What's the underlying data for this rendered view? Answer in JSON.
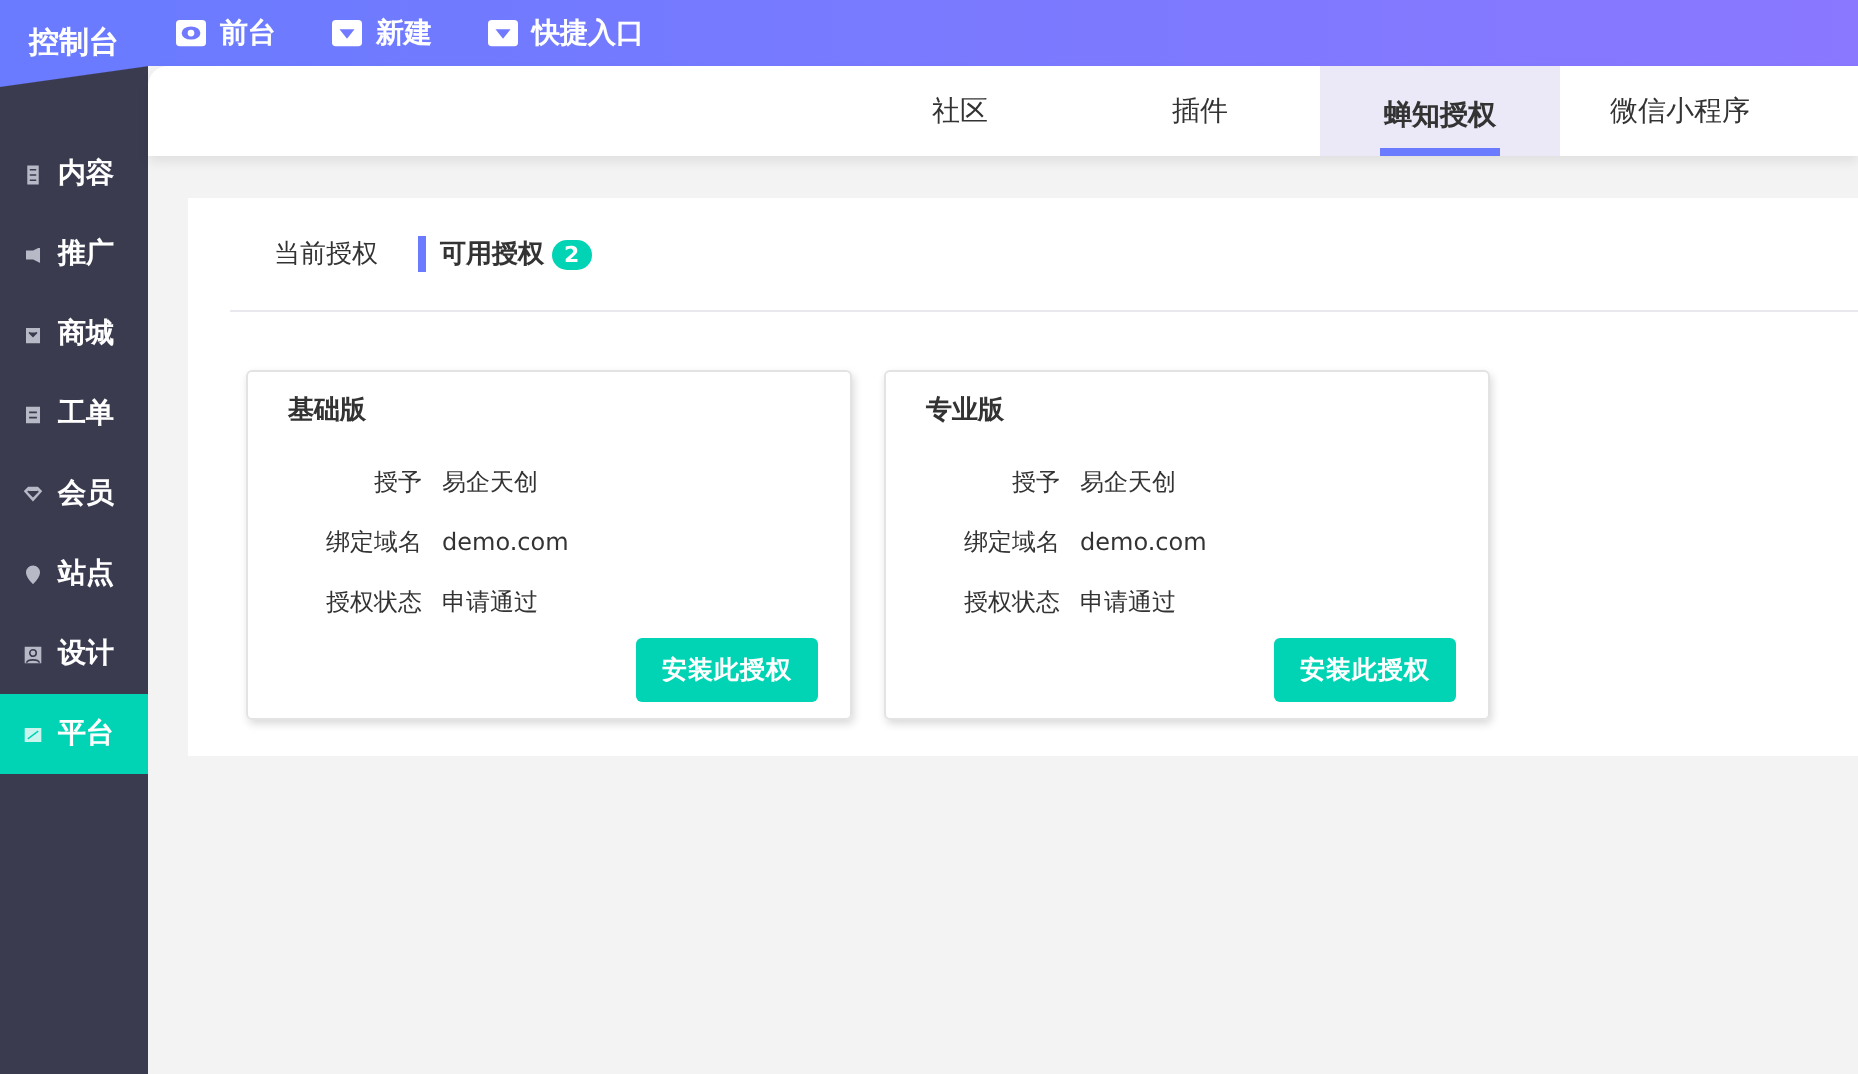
{
  "sidebar": {
    "logo": "控制台",
    "items": [
      {
        "label": "内容",
        "selected": false
      },
      {
        "label": "推广",
        "selected": false
      },
      {
        "label": "商城",
        "selected": false
      },
      {
        "label": "工单",
        "selected": false
      },
      {
        "label": "会员",
        "selected": false
      },
      {
        "label": "站点",
        "selected": false
      },
      {
        "label": "设计",
        "selected": false
      },
      {
        "label": "平台",
        "selected": true
      }
    ]
  },
  "top_bar": {
    "links": [
      {
        "label": "前台",
        "kind": "view"
      },
      {
        "label": "新建",
        "kind": "dropdown"
      },
      {
        "label": "快捷入口",
        "kind": "dropdown"
      }
    ]
  },
  "tabs": [
    {
      "label": "社区",
      "selected": false
    },
    {
      "label": "插件",
      "selected": false
    },
    {
      "label": "蝉知授权",
      "selected": true
    },
    {
      "label": "微信小程序",
      "selected": false
    }
  ],
  "sub_tabs": [
    {
      "label": "当前授权",
      "selected": false
    },
    {
      "label": "可用授权",
      "selected": true,
      "count": "2"
    }
  ],
  "cards": [
    {
      "title": "基础版",
      "fields": [
        {
          "label": "授予",
          "value": "易企天创"
        },
        {
          "label": "绑定域名",
          "value": "demo.com"
        },
        {
          "label": "授权状态",
          "value": "申请通过"
        }
      ],
      "button": "安装此授权"
    },
    {
      "title": "专业版",
      "fields": [
        {
          "label": "授予",
          "value": "易企天创"
        },
        {
          "label": "绑定域名",
          "value": "demo.com"
        },
        {
          "label": "授权状态",
          "value": "申请通过"
        }
      ],
      "button": "安装此授权"
    }
  ]
}
